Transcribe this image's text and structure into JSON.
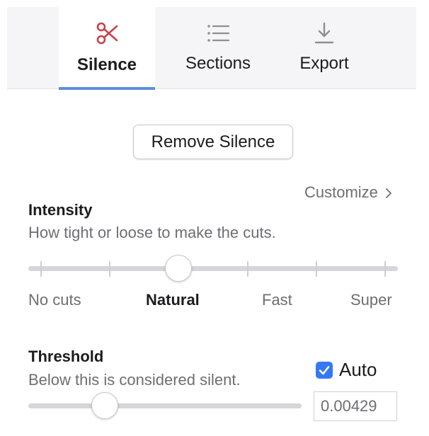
{
  "tabs": [
    {
      "label": "Silence",
      "icon": "scissors-icon",
      "active": true
    },
    {
      "label": "Sections",
      "icon": "list-icon",
      "active": false
    },
    {
      "label": "Export",
      "icon": "download-icon",
      "active": false
    }
  ],
  "actions": {
    "remove_silence_label": "Remove Silence"
  },
  "customize": {
    "label": "Customize"
  },
  "intensity": {
    "title": "Intensity",
    "description": "How tight or loose to make the cuts.",
    "steps": [
      "No cuts",
      "Natural",
      "Fast",
      "Super"
    ],
    "selected_step": "Natural"
  },
  "threshold": {
    "title": "Threshold",
    "description": "Below this is considered silent.",
    "auto_label": "Auto",
    "auto_checked": true,
    "value": "0.00429"
  },
  "colors": {
    "accent": "#5b8fd9",
    "scissors_icon": "#c9424c",
    "checkbox": "#3478f6"
  }
}
